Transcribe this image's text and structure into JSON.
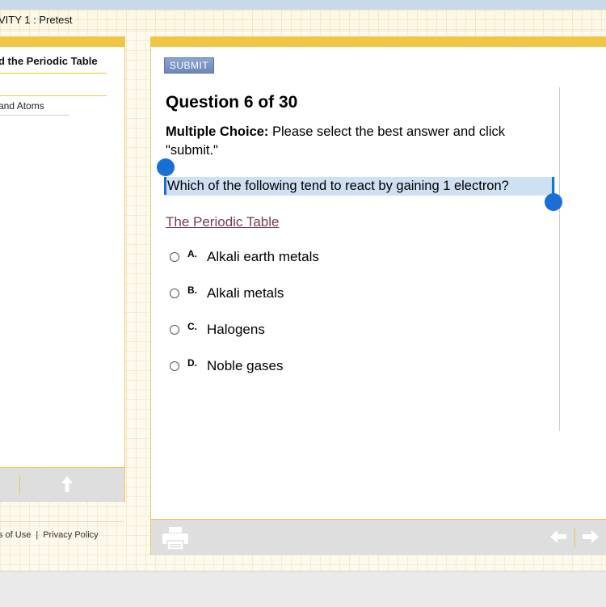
{
  "window": {
    "title": "VITY 1 : Pretest"
  },
  "sidebar": {
    "heading": "d the Periodic Table",
    "item": "and Atoms"
  },
  "footer": {
    "terms": "s of Use",
    "separator": "|",
    "privacy": "Privacy Policy"
  },
  "toolbar": {
    "submit_label": "SUBMIT"
  },
  "question": {
    "heading": "Question 6 of 30",
    "instruction_bold": "Multiple Choice:",
    "instruction_rest": " Please select the best answer and click \"submit.\"",
    "text": "Which of the following tend to react by gaining 1 electron?",
    "reference_link": "The Periodic Table",
    "options": [
      {
        "letter": "A.",
        "label": "Alkali earth metals"
      },
      {
        "letter": "B.",
        "label": "Alkali metals"
      },
      {
        "letter": "C.",
        "label": "Halogens"
      },
      {
        "letter": "D.",
        "label": "Noble gases"
      }
    ]
  },
  "icons": {
    "print": "printer-icon",
    "up": "arrow-up-icon",
    "back": "arrow-left-icon",
    "forward": "arrow-right-icon"
  },
  "colors": {
    "accent_yellow": "#f0c542",
    "selection": "#cfe0f3",
    "selection_handle": "#1a6fd6",
    "link": "#7a3a4e",
    "submit": "#6c86bc"
  }
}
